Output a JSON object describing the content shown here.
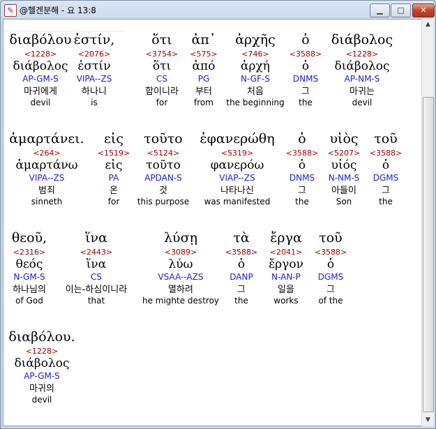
{
  "window": {
    "title": "@헬겐분해 - 요 13:8"
  },
  "words": [
    {
      "greek": "διαβόλου",
      "num": "<1228>",
      "lemma": "διάβολος",
      "pars": "AP-GM-S",
      "kor": "마귀에게",
      "eng": "devil"
    },
    {
      "greek": "ἐστίν,",
      "num": "<2076>",
      "lemma": "ἐστίν",
      "pars": "VIPA--ZS",
      "kor": "하나니",
      "eng": "is"
    },
    {
      "greek": "ὅτι",
      "num": "<3754>",
      "lemma": "ὅτι",
      "pars": "CS",
      "kor": "함이니라",
      "eng": "for"
    },
    {
      "greek": "ἀπ᾽",
      "num": "<575>",
      "lemma": "ἀπό",
      "pars": "PG",
      "kor": "부터",
      "eng": "from"
    },
    {
      "greek": "ἀρχῆς",
      "num": "<746>",
      "lemma": "ἀρχή",
      "pars": "N-GF-S",
      "kor": "처음",
      "eng": "the beginning"
    },
    {
      "greek": "ὁ",
      "num": "<3588>",
      "lemma": "ὁ",
      "pars": "DNMS",
      "kor": "그",
      "eng": "the"
    },
    {
      "greek": "διάβολος",
      "num": "<1228>",
      "lemma": "διάβολος",
      "pars": "AP-NM-S",
      "kor": "마귀는",
      "eng": "devil"
    },
    {
      "greek": "ἁμαρτάνει.",
      "num": "<264>",
      "lemma": "ἁμαρτάνω",
      "pars": "VIPA--ZS",
      "kor": "범죄",
      "eng": "sinneth"
    },
    {
      "greek": "εἰς",
      "num": "<1519>",
      "lemma": "εἰς",
      "pars": "PA",
      "kor": "온",
      "eng": "for"
    },
    {
      "greek": "τοῦτο",
      "num": "<5124>",
      "lemma": "τοῦτο",
      "pars": "APDAN-S",
      "kor": "것",
      "eng": "this purpose"
    },
    {
      "greek": "ἐφανερώθη",
      "num": "<5319>",
      "lemma": "φανερόω",
      "pars": "VIAP--ZS",
      "kor": "나타나신",
      "eng": "was manifested"
    },
    {
      "greek": "ὁ",
      "num": "<3588>",
      "lemma": "ὁ",
      "pars": "DNMS",
      "kor": "그",
      "eng": "the"
    },
    {
      "greek": "υἱὸς",
      "num": "<5207>",
      "lemma": "υἱός",
      "pars": "N-NM-S",
      "kor": "아들이",
      "eng": "Son"
    },
    {
      "greek": "τοῦ",
      "num": "<3588>",
      "lemma": "ὁ",
      "pars": "DGMS",
      "kor": "그",
      "eng": "the"
    },
    {
      "greek": "θεοῦ,",
      "num": "<2316>",
      "lemma": "θεός",
      "pars": "N-GM-S",
      "kor": "하나님의",
      "eng": "of God"
    },
    {
      "greek": "ἵνα",
      "num": "<2443>",
      "lemma": "ἵνα",
      "pars": "CS",
      "kor": "이는-하심이니라",
      "eng": "that"
    },
    {
      "greek": "λύσῃ",
      "num": "<3089>",
      "lemma": "λύω",
      "pars": "VSAA--AZS",
      "kor": "멸하려",
      "eng": "he mighte destroy"
    },
    {
      "greek": "τὰ",
      "num": "<3588>",
      "lemma": "ὁ",
      "pars": "DANP",
      "kor": "그",
      "eng": "the"
    },
    {
      "greek": "ἔργα",
      "num": "<2041>",
      "lemma": "ἔργον",
      "pars": "N-AN-P",
      "kor": "일을",
      "eng": "works"
    },
    {
      "greek": "τοῦ",
      "num": "<3588>",
      "lemma": "ὁ",
      "pars": "DGMS",
      "kor": "그",
      "eng": "of the"
    },
    {
      "greek": "διαβόλου.",
      "num": "<1228>",
      "lemma": "διάβολος",
      "pars": "AP-GM-S",
      "kor": "마귀의",
      "eng": "devil"
    }
  ]
}
